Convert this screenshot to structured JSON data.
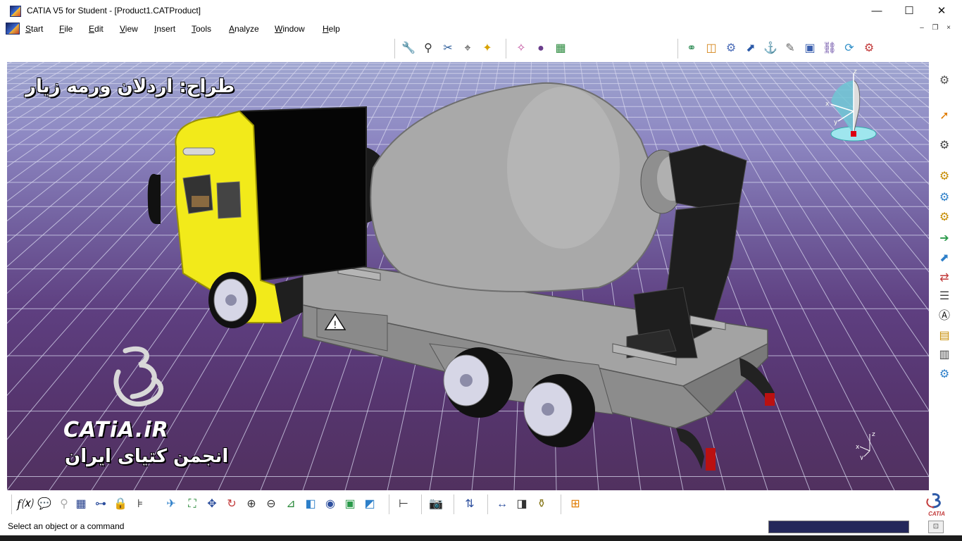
{
  "window": {
    "title": "CATIA V5 for Student - [Product1.CATProduct]",
    "controls": {
      "minimize": "—",
      "maximize": "☐",
      "close": "✕"
    }
  },
  "menu": {
    "items": [
      "Start",
      "File",
      "Edit",
      "View",
      "Insert",
      "Tools",
      "Analyze",
      "Window",
      "Help"
    ],
    "doc_controls": {
      "minimize": "–",
      "restore": "❐",
      "close": "×"
    }
  },
  "viewport": {
    "designer_caption": "طراح: اردلان ورمه زیار",
    "brand_name": "CATiA.iR",
    "brand_subtitle": "انجمن کتیای ایران",
    "compass_labels": {
      "x": "x",
      "y": "y",
      "z": "z"
    },
    "axis_labels": {
      "x": "x",
      "y": "y",
      "z": "z"
    }
  },
  "toolbars": {
    "top_groups": [
      [
        "wrench-icon",
        "magnifier-icon",
        "scissors-icon",
        "crosshair-icon",
        "star-icon"
      ],
      [
        "sparkle-icon",
        "sphere-icon",
        "blocks-icon"
      ],
      [
        "link-icon",
        "cube-icon",
        "gears-icon",
        "arrow-icon",
        "anchor-icon",
        "pencil-icon",
        "frame-icon",
        "chain-icon",
        "refresh-icon",
        "cog-icon"
      ]
    ],
    "right": [
      "gears-icon",
      "select-arrow-icon",
      "assembly-icon",
      "gear-icon",
      "gear-icon",
      "gear-icon",
      "arrow-right-icon",
      "arrow-up-icon",
      "swap-icon",
      "doc-icon",
      "text-icon",
      "tree-icon",
      "tree-icon",
      "network-icon"
    ],
    "bottom": [
      "formula-icon",
      "comment-icon",
      "marker-icon",
      "table-icon",
      "tree-icon",
      "lock-icon",
      "constraint-icon",
      "fly-icon",
      "fit-all-icon",
      "pan-icon",
      "rotate-icon",
      "zoom-in-icon",
      "zoom-out-icon",
      "normal-view-icon",
      "iso-view-icon",
      "shading-icon",
      "hide-show-icon",
      "swap-visible-icon",
      "ruler-icon",
      "camera-icon",
      "measure-icon",
      "measure-between-icon",
      "measure-item-icon",
      "inertia-icon",
      "grid-icon"
    ]
  },
  "status": {
    "message": "Select an object or a command",
    "command_input": "",
    "logo_text": "CATIA"
  },
  "colors": {
    "cab_yellow": "#f2ea1a",
    "drum_gray": "#a8a8a8",
    "chassis_gray": "#9a9a9a",
    "grid_line": "#d8d8ef",
    "background_top": "#9fa6d0",
    "background_bottom": "#51315f",
    "status_input": "#24285a"
  }
}
